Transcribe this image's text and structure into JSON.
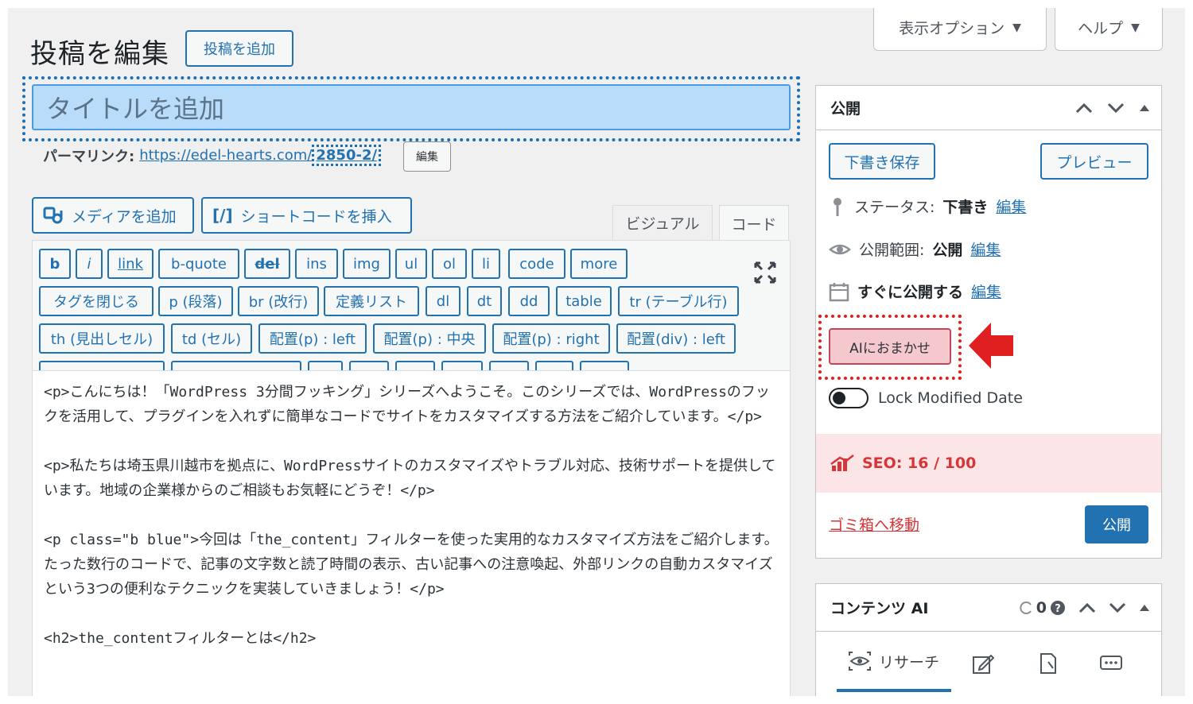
{
  "page": {
    "title": "投稿を編集",
    "add_new_label": "投稿を追加"
  },
  "screen_meta": {
    "options_label": "表示オプション",
    "help_label": "ヘルプ",
    "arrow": "▼"
  },
  "post": {
    "title_placeholder": "タイトルを追加",
    "permalink_label": "パーマリンク:",
    "permalink_url": "https://edel-hearts.com/",
    "permalink_slug": "2850-2/",
    "permalink_edit_label": "編集"
  },
  "media": {
    "add_media_label": "メディアを追加",
    "shortcode_label": "ショートコードを挿入",
    "shortcode_icon": "[/]"
  },
  "editor": {
    "tab_visual": "ビジュアル",
    "tab_code": "コード",
    "quicktags_row1": [
      "b",
      "i",
      "link",
      "b-quote",
      "del",
      "ins",
      "img",
      "ul",
      "ol",
      "li",
      "code",
      "more"
    ],
    "quicktags_row2": [
      "タグを閉じる",
      "p (段落)",
      "br (改行)",
      "定義リスト",
      "dl",
      "dt",
      "dd",
      "table",
      "tr (テーブル行)"
    ],
    "quicktags_row3": [
      "th (見出しセル)",
      "td (セル)",
      "配置(p) : left",
      "配置(p) : 中央",
      "配置(p) : right",
      "配置(div) : left"
    ],
    "content": [
      "<p>こんにちは！「WordPress 3分間フッキング」シリーズへようこそ。このシリーズでは、WordPressのフックを活用して、プラグインを入れずに簡単なコードでサイトをカスタマイズする方法をご紹介しています。</p>",
      "<p>私たちは埼玉県川越市を拠点に、WordPressサイトのカスタマイズやトラブル対応、技術サポートを提供しています。地域の企業様からのご相談もお気軽にどうぞ！</p>",
      "<p class=\"b blue\">今回は「the_content」フィルターを使った実用的なカスタマイズ方法をご紹介します。たった数行のコードで、記事の文字数と読了時間の表示、古い記事への注意喚起、外部リンクの自動カスタマイズという3つの便利なテクニックを実装していきましょう！</p>",
      "<h2>the_contentフィルターとは</h2>"
    ]
  },
  "publish_box": {
    "title": "公開",
    "save_draft_label": "下書き保存",
    "preview_label": "プレビュー",
    "status_label": "ステータス:",
    "status_value": "下書き",
    "visibility_label": "公開範囲:",
    "visibility_value": "公開",
    "schedule_value": "すぐに公開する",
    "edit_link": "編集",
    "ai_button_label": "AIにおまかせ",
    "lock_label": "Lock Modified Date",
    "seo_label": "SEO: 16 / 100",
    "trash_label": "ゴミ箱へ移動",
    "publish_label": "公開"
  },
  "content_ai_box": {
    "title": "コンテンツ AI",
    "credits": "0",
    "research_tab": "リサーチ"
  },
  "colors": {
    "accent": "#2271b1",
    "focus_outline": "#1a6fb5",
    "title_bg": "#b8dcfa",
    "seo_bg": "#fbe5e6",
    "danger": "#d63638",
    "arrow": "#e02020"
  }
}
